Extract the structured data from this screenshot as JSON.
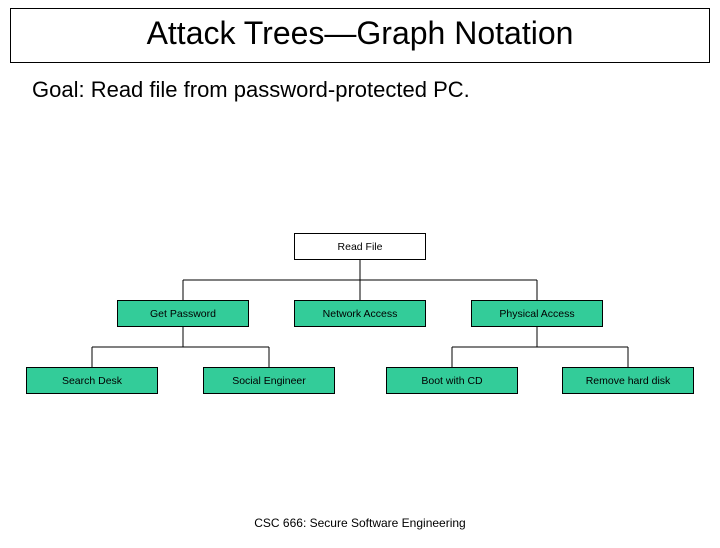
{
  "slide": {
    "title": "Attack Trees—Graph Notation",
    "goal": "Goal: Read file from password-protected PC.",
    "footer": "CSC 666: Secure Software Engineering"
  },
  "tree": {
    "root": {
      "label": "Read File"
    },
    "level2": [
      {
        "label": "Get Password"
      },
      {
        "label": "Network Access"
      },
      {
        "label": "Physical Access"
      }
    ],
    "level3": [
      {
        "label": "Search Desk"
      },
      {
        "label": "Social Engineer"
      },
      {
        "label": "Boot with CD"
      },
      {
        "label": "Remove hard disk"
      }
    ]
  }
}
